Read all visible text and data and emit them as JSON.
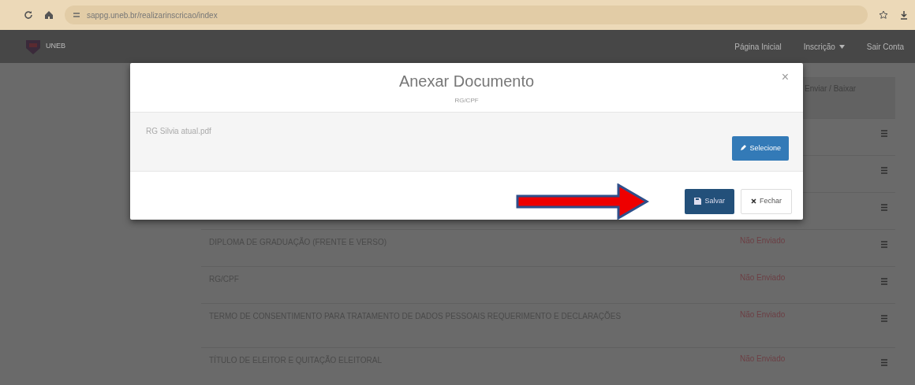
{
  "browser": {
    "url": "sappg.uneb.br/realizarinscricao/index"
  },
  "navbar": {
    "logo": "UNEB",
    "items": [
      {
        "label": "Página Inicial",
        "caret": false
      },
      {
        "label": "Inscrição",
        "caret": true
      },
      {
        "label": "Sair Conta",
        "caret": false
      }
    ]
  },
  "table": {
    "columns": [
      {},
      {},
      {
        "label": "Enviar / Baixar"
      }
    ],
    "rows": [
      {
        "document": "",
        "status": ""
      },
      {
        "document": "",
        "status": ""
      },
      {
        "document": "",
        "status": ""
      },
      {
        "document": "DIPLOMA DE GRADUAÇÃO (FRENTE E VERSO)",
        "status": "Não Enviado"
      },
      {
        "document": "RG/CPF",
        "status": "Não Enviado"
      },
      {
        "document": "TERMO DE CONSENTIMENTO PARA TRATAMENTO DE DADOS PESSOAIS REQUERIMENTO E DECLARAÇÕES",
        "status": "Não Enviado"
      },
      {
        "document": "TÍTULO DE ELEITOR E QUITAÇÃO ELEITORAL",
        "status": "Não Enviado"
      }
    ]
  },
  "modal": {
    "title": "Anexar Documento",
    "subtitle": "RG/CPF",
    "close": "×",
    "file_name": "RG Silvia atual.pdf",
    "select_button": "Selecione",
    "buttons": [
      {
        "kind": "primary",
        "label": "Salvar"
      },
      {
        "kind": "default",
        "label": "Fechar"
      }
    ]
  }
}
